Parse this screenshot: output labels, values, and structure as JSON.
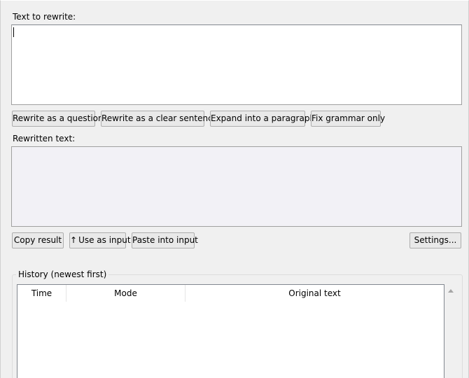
{
  "input": {
    "label": "Text to rewrite:",
    "value": ""
  },
  "actions": {
    "buttons": [
      {
        "label": "Rewrite as a question"
      },
      {
        "label": "Rewrite as a clear sentence"
      },
      {
        "label": "Expand into a paragraph"
      },
      {
        "label": "Fix grammar only"
      }
    ]
  },
  "output": {
    "label": "Rewritten text:",
    "value": ""
  },
  "result_actions": {
    "copy": "Copy result",
    "use_as_input_arrow": "↑",
    "use_as_input": "Use as input",
    "paste": "Paste into input",
    "settings": "Settings..."
  },
  "history": {
    "title": "History (newest first)",
    "columns": [
      "Time",
      "Mode",
      "Original text"
    ],
    "rows": []
  },
  "icons": {
    "scroll_up": "triangle-up-icon"
  }
}
